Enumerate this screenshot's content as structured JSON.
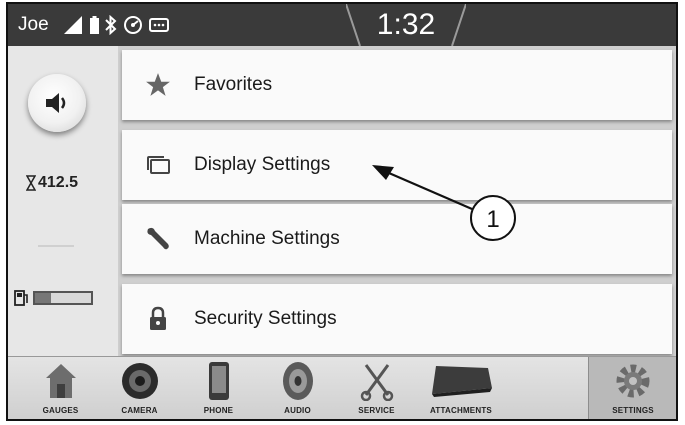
{
  "status_bar": {
    "user": "Joe",
    "time": "1:32"
  },
  "left_rail": {
    "hour_meter": "412.5",
    "fuel_level": 0.28
  },
  "menu": {
    "items": [
      {
        "label": "Favorites",
        "icon": "star-icon"
      },
      {
        "label": "Display Settings",
        "icon": "display-icon"
      },
      {
        "label": "Machine Settings",
        "icon": "wrench-icon"
      },
      {
        "label": "Security Settings",
        "icon": "lock-icon"
      }
    ]
  },
  "dock": {
    "tabs": [
      {
        "label": "GAUGES",
        "icon": "gauges-icon"
      },
      {
        "label": "CAMERA",
        "icon": "camera-icon"
      },
      {
        "label": "PHONE",
        "icon": "phone-icon"
      },
      {
        "label": "AUDIO",
        "icon": "speaker-icon"
      },
      {
        "label": "SERVICE",
        "icon": "service-icon"
      },
      {
        "label": "ATTACHMENTS",
        "icon": "bucket-icon"
      },
      {
        "label": "SETTINGS",
        "icon": "gear-icon"
      }
    ],
    "active": "SETTINGS"
  },
  "callout": {
    "number": "1"
  }
}
